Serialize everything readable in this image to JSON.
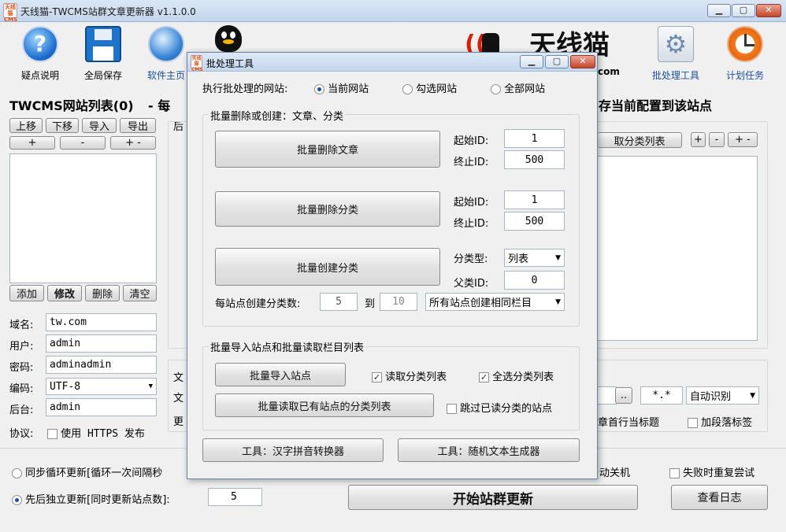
{
  "app": {
    "logo_text": "天线猫\nCMS",
    "title": "天线猫-TWCMS站群文章更新器 v1.1.0.0",
    "min": "▁",
    "max": "▢",
    "close": "✕"
  },
  "toolbar": {
    "help": "疑点说明",
    "save": "全局保存",
    "home": "软件主页",
    "batch": "批处理工具",
    "schedule": "计划任务",
    "brand": "天线猫",
    "brand_domain": "com"
  },
  "header": {
    "site_list_title": "TWCMS网站列表(0)",
    "site_list_sep": "- 每",
    "save_config": "存当前配置到该站点"
  },
  "sitelist": {
    "up": "上移",
    "down": "下移",
    "import": "导入",
    "export": "导出",
    "plus": "+",
    "minus": "-",
    "pm": "+ -",
    "add": "添加",
    "edit": "修改",
    "delete": "删除",
    "clear": "清空"
  },
  "form": {
    "domain_label": "域名:",
    "domain": "tw.com",
    "user_label": "用户:",
    "user": "admin",
    "pass_label": "密码:",
    "pass": "adminadmin",
    "enc_label": "编码:",
    "enc": "UTF-8",
    "admin_label": "后台:",
    "admin": "admin",
    "proto_label": "协议:",
    "https": "使用 HTTPS 发布"
  },
  "right": {
    "cat_list": "取分类列表",
    "plus": "+",
    "minus": "-",
    "pm": "+ -",
    "rest_back": "后",
    "ellipsis": "..",
    "glob": "*.*",
    "auto": "自动识别",
    "first_line": "章首行当标题",
    "add_tags": "加段落标签",
    "wen1": "文",
    "wen2": "文",
    "geng": "更",
    "shutdown": "动关机",
    "retry": "失败时重复尝试"
  },
  "bottom": {
    "sync": "同步循环更新[循环一次间隔秒",
    "seq": "先后独立更新[同时更新站点数]:",
    "seq_count": "5",
    "start": "开始站群更新",
    "log": "查看日志"
  },
  "dialog": {
    "logo_text": "天线猫\nCMS",
    "title": "批处理工具",
    "exec_label": "执行批处理的网站:",
    "opt_current": "当前网站",
    "opt_checked": "勾选网站",
    "opt_all": "全部网站",
    "g1_title": "批量删除或创建：文章、分类",
    "del_articles": "批量删除文章",
    "del_cats": "批量删除分类",
    "create_cats": "批量创建分类",
    "start_id": "起始ID:",
    "end_id": "终止ID:",
    "a_start": "1",
    "a_end": "500",
    "c_start": "1",
    "c_end": "500",
    "cat_type": "分类型:",
    "cat_type_val": "列表",
    "parent_id": "父类ID:",
    "parent_val": "0",
    "per_site": "每站点创建分类数:",
    "per_from": "5",
    "to": "到",
    "per_to": "10",
    "same_col": "所有站点创建相同栏目",
    "g2_title": "批量导入站点和批量读取栏目列表",
    "import_sites": "批量导入站点",
    "read_cats": "读取分类列表",
    "select_all": "全选分类列表",
    "batch_read": "批量读取已有站点的分类列表",
    "skip_read": "跳过已读分类的站点",
    "tool_pinyin": "工具：汉字拼音转换器",
    "tool_random": "工具：随机文本生成器"
  },
  "colors": {
    "accent": "#1b4fa0",
    "brand_red": "#d81e06"
  },
  "icons": [
    "help-icon",
    "floppy-icon",
    "globe-icon",
    "qq-penguin-icon",
    "gear-icon",
    "clock-icon",
    "radio-wave-cat-icon"
  ]
}
